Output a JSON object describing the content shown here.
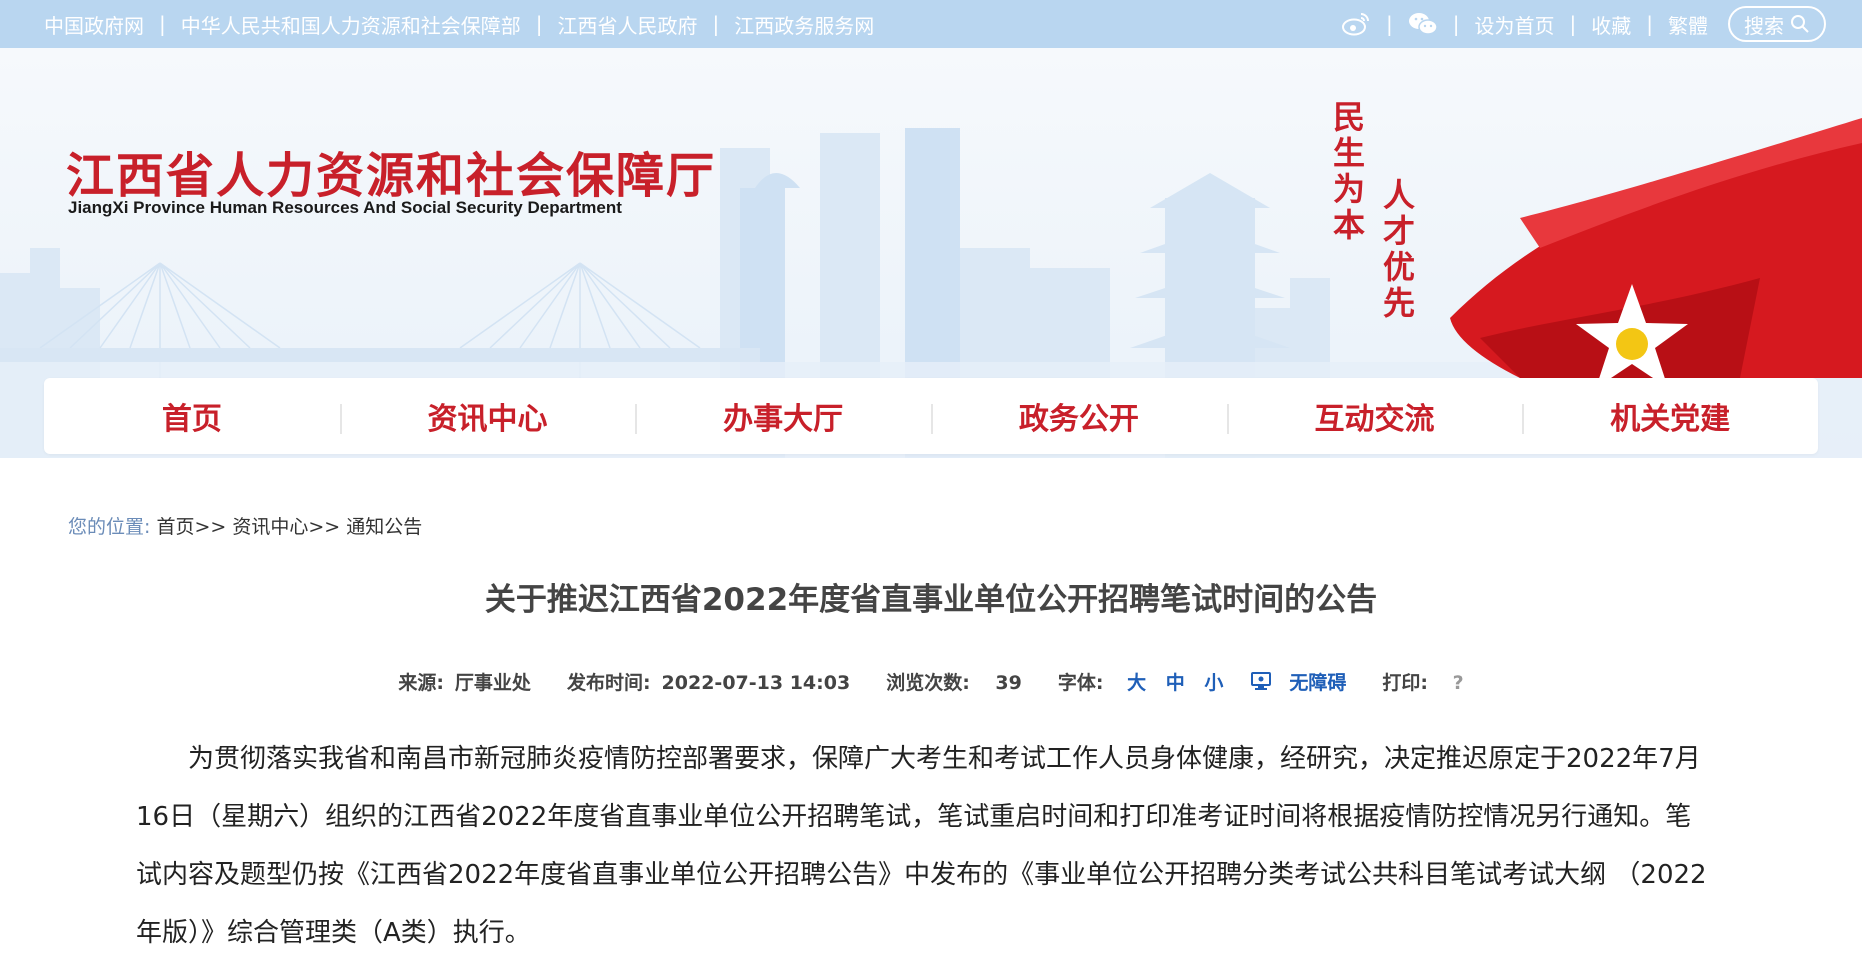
{
  "topbar": {
    "links": [
      "中国政府网",
      "中华人民共和国人力资源和社会保障部",
      "江西省人民政府",
      "江西政务服务网"
    ],
    "separator": "|",
    "actions": [
      "设为首页",
      "收藏",
      "繁體"
    ],
    "search_label": "搜索",
    "bg_color": "#b9d6f0"
  },
  "header": {
    "title": "江西省人力资源和社会保障厅",
    "subtitle": "JiangXi Province Human Resources And Social Security Department",
    "slogan_left": "民生为本",
    "slogan_right": "人才优先",
    "brand_color": "#c8202a"
  },
  "nav": {
    "items": [
      "首页",
      "资讯中心",
      "办事大厅",
      "政务公开",
      "互动交流",
      "机关党建"
    ]
  },
  "breadcrumb": {
    "label": "您的位置:",
    "items": [
      "首页>>",
      "资讯中心>>",
      "通知公告"
    ]
  },
  "article": {
    "title": "关于推迟江西省2022年度省直事业单位公开招聘笔试时间的公告",
    "meta": {
      "source_label": "来源:",
      "source": "厅事业处",
      "time_label": "发布时间:",
      "time": "2022-07-13 14:03",
      "views_label": "浏览次数:",
      "views": "39",
      "font_label": "字体:",
      "font_large": "大",
      "font_medium": "中",
      "font_small": "小",
      "accessibility": "无障碍",
      "print_label": "打印:",
      "print_icon": "?"
    },
    "body": "为贯彻落实我省和南昌市新冠肺炎疫情防控部署要求，保障广大考生和考试工作人员身体健康，经研究，决定推迟原定于2022年7月16日（星期六）组织的江西省2022年度省直事业单位公开招聘笔试，笔试重启时间和打印准考证时间将根据疫情防控情况另行通知。笔试内容及题型仍按《江西省2022年度省直事业单位公开招聘公告》中发布的《事业单位公开招聘分类考试公共科目笔试考试大纲 （2022年版）》综合管理类（A类）执行。"
  }
}
